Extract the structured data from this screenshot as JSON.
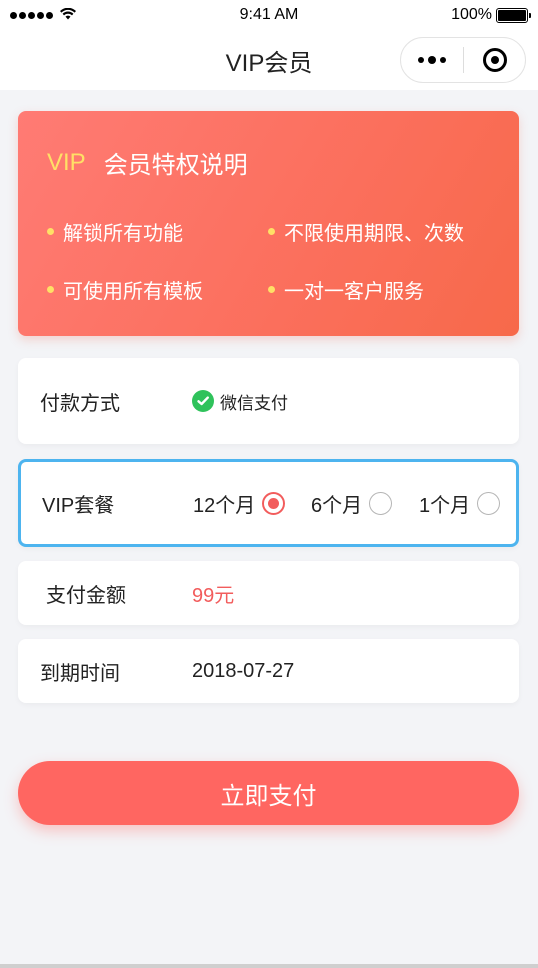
{
  "status_bar": {
    "time": "9:41 AM",
    "battery": "100%",
    "battery_level": 1.0
  },
  "nav": {
    "title": "VIP会员"
  },
  "vip_card": {
    "tag": "VIP",
    "title": "会员特权说明",
    "perks": [
      "解锁所有功能",
      "不限使用期限、次数",
      "可使用所有模板",
      "一对一客户服务"
    ]
  },
  "payment": {
    "label": "付款方式",
    "method": "微信支付",
    "icon": "wechat-pay-icon"
  },
  "plan": {
    "label": "VIP套餐",
    "options": [
      {
        "label": "12个月",
        "selected": true
      },
      {
        "label": "6个月",
        "selected": false
      },
      {
        "label": "1个月",
        "selected": false
      }
    ]
  },
  "amount": {
    "label": "支付金额",
    "value": "99元"
  },
  "expiry": {
    "label": "到期时间",
    "value": "2018-07-27"
  },
  "actions": {
    "pay_label": "立即支付"
  },
  "colors": {
    "accent": "#ff6661",
    "price": "#f25c5c",
    "selected_border": "#4db4ef",
    "vip_tag": "#ffe066"
  }
}
